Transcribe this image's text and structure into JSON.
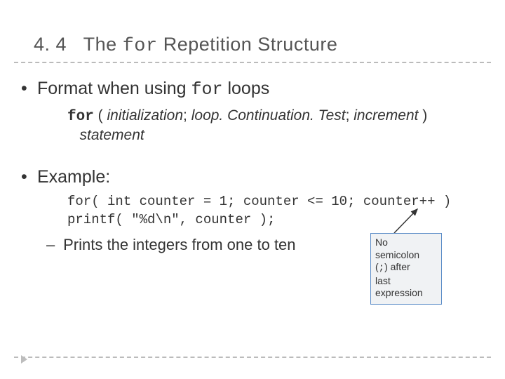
{
  "heading": {
    "number": "4. 4",
    "pre": "The ",
    "kw": "for",
    "post": " Repetition Structure"
  },
  "bullets": {
    "format_pre": "Format when using ",
    "format_kw": "for",
    "format_post": " loops",
    "example": "Example:"
  },
  "syntax": {
    "kw": "for",
    "open": " ( ",
    "init": "initialization",
    "sep1": "; ",
    "cond": "loop. Continuation. Test",
    "sep2": "; ",
    "inc": "increment",
    "close": " )",
    "stmt": "statement"
  },
  "code": {
    "line1": "for( int counter = 1; counter <= 10; counter++ )",
    "line2": "   printf( \"%d\\n\", counter );"
  },
  "dash": {
    "text": "Prints the integers from one to ten"
  },
  "callout": {
    "l1": "No",
    "l2": "semicolon",
    "l3a": "(",
    "l3b": ";",
    "l3c": ") after",
    "l4": "last",
    "l5": "expression"
  }
}
